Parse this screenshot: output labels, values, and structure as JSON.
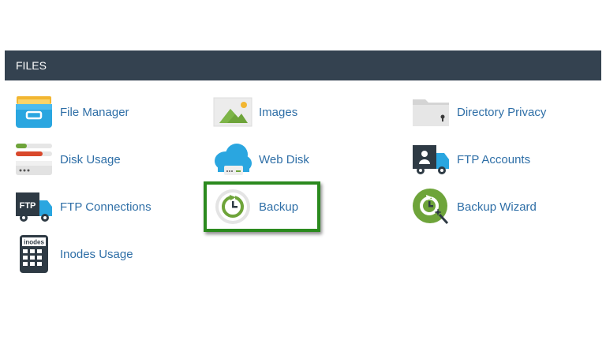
{
  "panel": {
    "title": "FILES"
  },
  "items": [
    {
      "label": "File Manager",
      "icon": "file-manager-icon"
    },
    {
      "label": "Images",
      "icon": "images-icon"
    },
    {
      "label": "Directory Privacy",
      "icon": "directory-privacy-icon"
    },
    {
      "label": "Disk Usage",
      "icon": "disk-usage-icon"
    },
    {
      "label": "Web Disk",
      "icon": "web-disk-icon"
    },
    {
      "label": "FTP Accounts",
      "icon": "ftp-accounts-icon"
    },
    {
      "label": "FTP Connections",
      "icon": "ftp-connections-icon"
    },
    {
      "label": "Backup",
      "icon": "backup-icon"
    },
    {
      "label": "Backup Wizard",
      "icon": "backup-wizard-icon"
    },
    {
      "label": "Inodes Usage",
      "icon": "inodes-usage-icon"
    }
  ],
  "icon_text": {
    "ftp": "FTP",
    "inodes": "inodes"
  },
  "highlighted_item": "Backup",
  "colors": {
    "header_bg": "#344250",
    "link": "#2f6fa7",
    "highlight_border": "#2b8a1e"
  }
}
